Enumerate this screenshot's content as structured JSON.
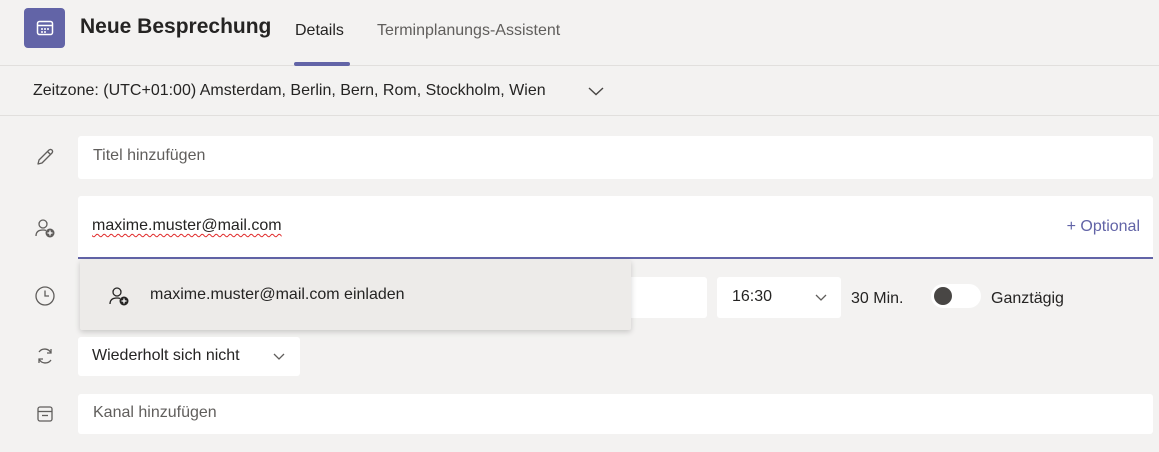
{
  "header": {
    "title": "Neue Besprechung",
    "tabs": [
      {
        "label": "Details",
        "active": true
      },
      {
        "label": "Terminplanungs-Assistent",
        "active": false
      }
    ],
    "icon": "calendar-icon",
    "accent": "#6264a7"
  },
  "timezone": {
    "label": "Zeitzone: (UTC+01:00) Amsterdam, Berlin, Bern, Rom, Stockholm, Wien"
  },
  "title_field": {
    "placeholder": "Titel hinzufügen",
    "icon": "pencil-icon"
  },
  "attendees": {
    "value": "maxime.muster@mail.com",
    "optional_label": "+ Optional",
    "icon": "add-person-icon"
  },
  "suggestion": {
    "label": "maxime.muster@mail.com einladen",
    "icon": "add-person-icon"
  },
  "time_row": {
    "icon": "clock-icon",
    "end_time": "16:30",
    "duration": "30 Min.",
    "all_day_label": "Ganztägig",
    "all_day_on": false
  },
  "recurrence": {
    "value": "Wiederholt sich nicht",
    "icon": "repeat-icon"
  },
  "channel": {
    "placeholder": "Kanal hinzufügen",
    "icon": "channel-icon"
  }
}
